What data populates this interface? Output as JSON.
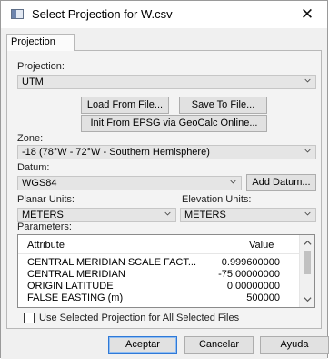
{
  "window": {
    "title": "Select Projection for W.csv",
    "close_glyph": "✕"
  },
  "tabs": [
    {
      "label": "Projection",
      "selected": true
    }
  ],
  "projection": {
    "label": "Projection:",
    "value": "UTM"
  },
  "buttons": {
    "load_from_file": "Load From File...",
    "save_to_file": "Save To File...",
    "init_from_epsg": "Init From EPSG via GeoCalc Online...",
    "add_datum": "Add Datum...",
    "accept": "Aceptar",
    "cancel": "Cancelar",
    "help": "Ayuda"
  },
  "zone": {
    "label": "Zone:",
    "value": "-18 (78°W - 72°W - Southern Hemisphere)"
  },
  "datum": {
    "label": "Datum:",
    "value": "WGS84"
  },
  "planar_units": {
    "label": "Planar Units:",
    "value": "METERS"
  },
  "elevation_units": {
    "label": "Elevation Units:",
    "value": "METERS"
  },
  "parameters": {
    "label": "Parameters:",
    "columns": [
      "Attribute",
      "Value"
    ],
    "rows": [
      {
        "attribute": "CENTRAL MERIDIAN SCALE FACT...",
        "value": "0.999600000"
      },
      {
        "attribute": "CENTRAL MERIDIAN",
        "value": "-75.00000000"
      },
      {
        "attribute": "ORIGIN LATITUDE",
        "value": "0.00000000"
      },
      {
        "attribute": "FALSE EASTING (m)",
        "value": "500000"
      }
    ]
  },
  "use_for_all": {
    "label": "Use Selected Projection for All Selected Files",
    "checked": false
  },
  "icons": {
    "app": "window-icon",
    "dropdown": "chevron-down-icon",
    "scroll_up": "chevron-up-icon",
    "scroll_down": "chevron-down-icon"
  }
}
